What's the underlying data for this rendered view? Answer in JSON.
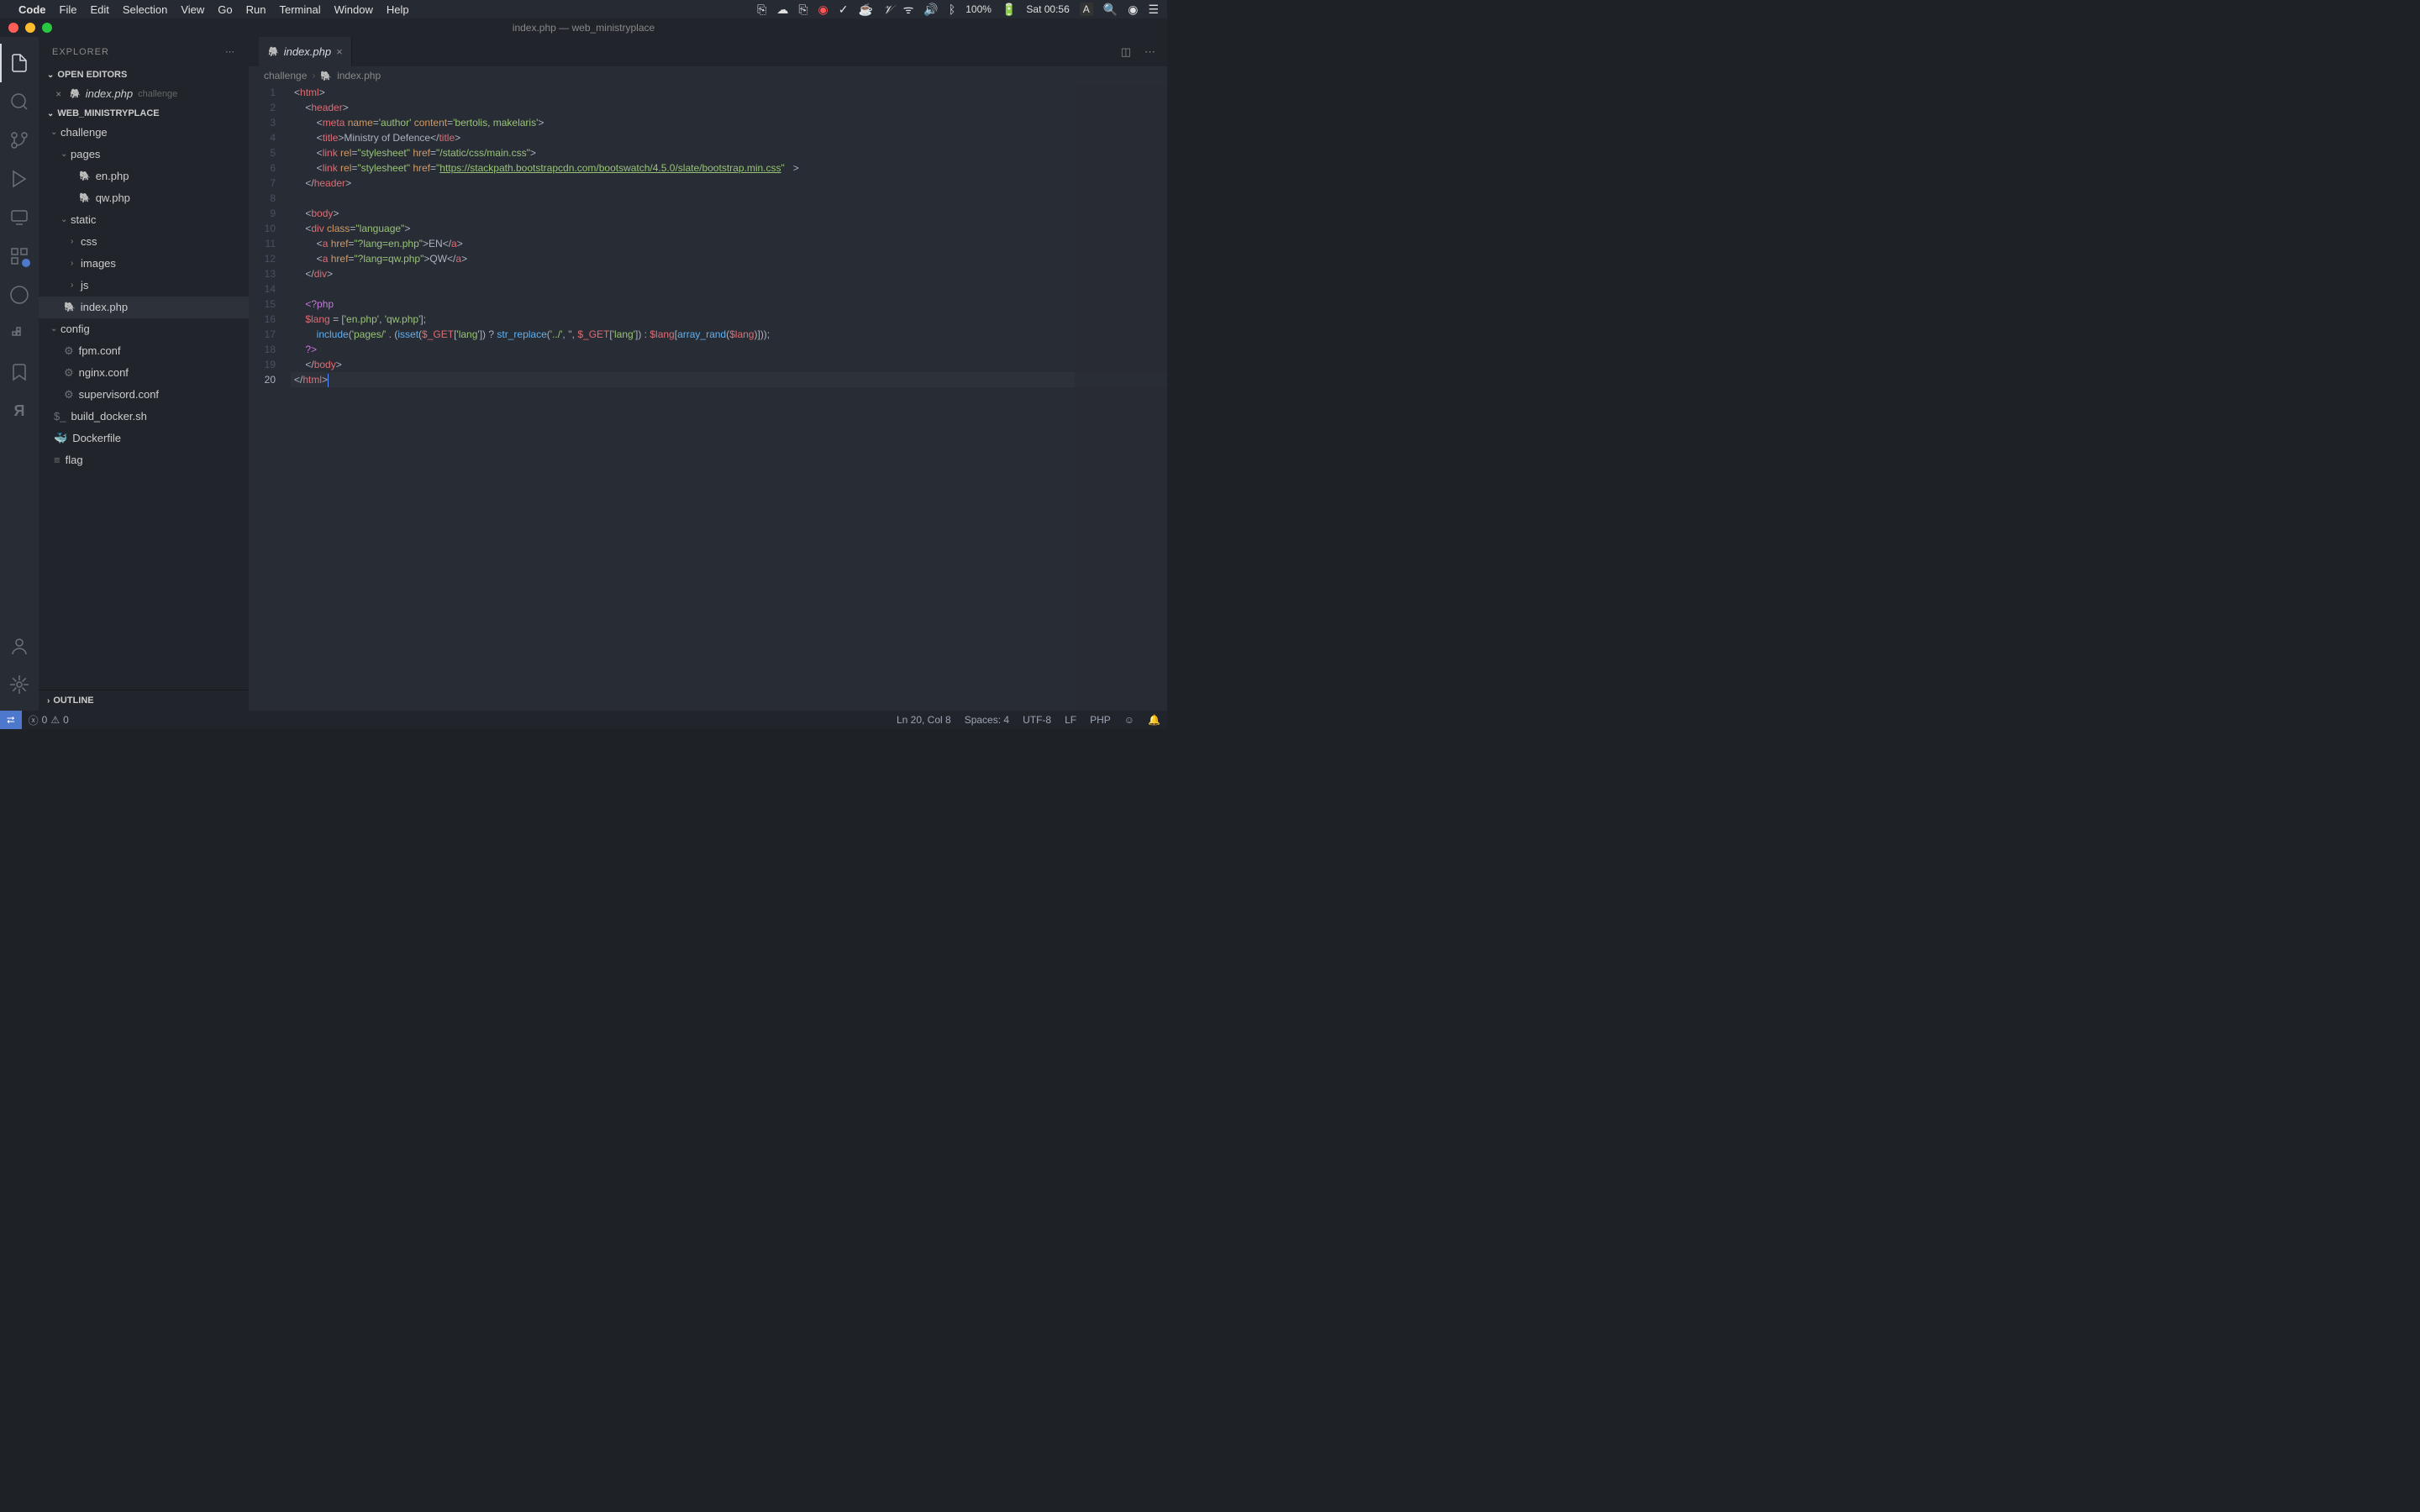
{
  "menubar": {
    "app": "Code",
    "items": [
      "File",
      "Edit",
      "Selection",
      "View",
      "Go",
      "Run",
      "Terminal",
      "Window",
      "Help"
    ],
    "battery": "100%",
    "datetime": "Sat 00:56",
    "lang_indicator": "A"
  },
  "titlebar": {
    "title": "index.php — web_ministryplace"
  },
  "sidebar": {
    "header": "EXPLORER",
    "sections": {
      "open_editors": "OPEN EDITORS",
      "workspace": "WEB_MINISTRYPLACE",
      "outline": "OUTLINE"
    },
    "open_editor": {
      "name": "index.php",
      "desc": "challenge"
    },
    "tree": {
      "challenge": "challenge",
      "pages": "pages",
      "en_php": "en.php",
      "qw_php": "qw.php",
      "static": "static",
      "css": "css",
      "images": "images",
      "js": "js",
      "index_php": "index.php",
      "config": "config",
      "fpm_conf": "fpm.conf",
      "nginx_conf": "nginx.conf",
      "supervisord_conf": "supervisord.conf",
      "build_docker": "build_docker.sh",
      "dockerfile": "Dockerfile",
      "flag": "flag"
    }
  },
  "tabs": {
    "active": "index.php"
  },
  "breadcrumb": {
    "parts": [
      "challenge",
      "index.php"
    ]
  },
  "code": {
    "line1": "<html>",
    "line2": "    <header>",
    "line3": "        <meta name='author' content='bertolis, makelaris'>",
    "line4": "        <title>Ministry of Defence</title>",
    "line5": "        <link rel=\"stylesheet\" href=\"/static/css/main.css\">",
    "line6_a": "        <link rel=\"stylesheet\" href=\"",
    "line6_url": "https://stackpath.bootstrapcdn.com/bootswatch/4.5.0/slate/bootstrap.min.css",
    "line6_b": "\"   >",
    "line7": "    </header>",
    "line8": "",
    "line9": "    <body>",
    "line10": "    <div class=\"language\">",
    "line11": "        <a href=\"?lang=en.php\">EN</a>",
    "line12": "        <a href=\"?lang=qw.php\">QW</a>",
    "line13": "    </div>",
    "line14": "",
    "line15": "    <?php",
    "line16": "    $lang = ['en.php', 'qw.php'];",
    "line17": "        include('pages/' . (isset($_GET['lang']) ? str_replace('../', '', $_GET['lang']) : $lang[array_rand($lang)]));",
    "line18": "    ?>",
    "line19": "    </body>",
    "line20": "</html>"
  },
  "statusbar": {
    "errors": "0",
    "warnings": "0",
    "ln_col": "Ln 20, Col 8",
    "spaces": "Spaces: 4",
    "encoding": "UTF-8",
    "eol": "LF",
    "language": "PHP"
  }
}
